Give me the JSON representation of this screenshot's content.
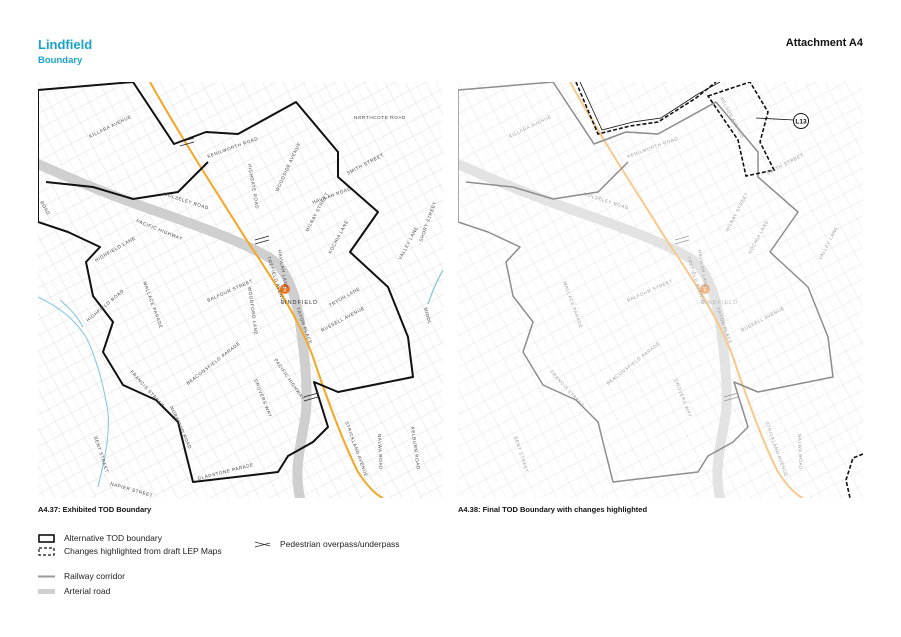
{
  "header": {
    "title": "Lindfield",
    "subtitle": "Boundary",
    "attachment": "Attachment A4"
  },
  "maps": [
    {
      "caption": "A4.37: Exhibited TOD Boundary",
      "labels": {
        "northcote": "NORTHCOTE ROAD",
        "killara": "KILLARA AVENUE",
        "kenilworth": "KENILWORTH ROAD",
        "highgate": "HIGHGATE ROAD",
        "woodside": "WOODSIDE AVENUE",
        "smith": "SMITH STREET",
        "wolseley": "WOLSELEY ROAD",
        "havilah": "HAVILAH ROAD",
        "milray": "MILRAY STREET",
        "havilah_lane": "HAVILAH LANE",
        "kochia": "KOCHIA LANE",
        "pacific_hwy": "PACIFIC HIGHWAY",
        "highfield_lane": "HIGHFIELD LANE",
        "highfield_road": "HIGHFIELD ROAD",
        "balfour": "BALFOUR STREET",
        "wallace": "WALLACE PARADE",
        "tryon_lane": "TRYON LANE",
        "russell": "RUSSELL AVENUE",
        "valley": "VALLEY LANE",
        "short": "SHORT STREET",
        "lindfield": "LINDFIELD",
        "woodford": "WOODFORD LANE",
        "tryon_place": "TRYON PLACE",
        "francis": "FRANCIS STREET",
        "beaconsfield": "BEACONSFIELD PARADE",
        "drovers": "DROVERS WAY",
        "strickland": "STRICKLAND AVENUE",
        "nalwa": "NALWA ROAD",
        "kelburn": "KELBURN ROAD",
        "norwood": "NORWOOD ROAD",
        "bent": "BENT STREET",
        "napier": "NAPIER STREET",
        "gladstone": "GLADSTONE PARADE",
        "pacific_hwy2": "PACIFIC HIGHWAY",
        "middle": "MIDDL",
        "road_edge": "ROAD",
        "treffield": "TREFIELD AVENUE"
      }
    },
    {
      "caption": "A4.38: Final TOD Boundary with changes highlighted",
      "labels": {
        "lindfield": "LINDFIELD",
        "callout": "L13",
        "smith": "SMITH STREET",
        "wolseley": "WOLSELEY ROAD",
        "kenilworth": "KENILWORTH ROAD",
        "balfour": "BALFOUR STREET",
        "wallace": "WALLACE PARADE",
        "russell": "RUSSELL AVENUE",
        "francis": "FRANCIS STREET",
        "beaconsfield": "BEACONSFIELD PARADE",
        "bent": "BENT STREET",
        "strickland": "STRICKLAND AVENUE",
        "tryon_place": "TRYON PLACE",
        "nelson": "NELSON AVENUE",
        "havilah": "HAVILAH LANE",
        "milray": "MILRAY STREET",
        "valley": "VALLEY LANE",
        "nalwa": "NALWA ROAD",
        "killara": "KILLARA AVENUE",
        "drovers": "DROVERS WAY",
        "trefield": "TREFIELD AVENUE",
        "kochia": "KOCHIA LANE"
      }
    }
  ],
  "legend": {
    "alt_boundary": "Alternative TOD boundary",
    "changes": "Changes highlighted from draft LEP Maps",
    "railway": "Railway corridor",
    "arterial": "Arterial road",
    "pedestrian": "Pedestrian overpass/underpass"
  },
  "colors": {
    "accent": "#1aa3c9",
    "railway": "#f5a623",
    "railway_faded": "#f7c98a",
    "boundary": "#111111",
    "arterial": "#c8c8c8",
    "station": "#e8762b",
    "water": "#7fc4e0"
  }
}
